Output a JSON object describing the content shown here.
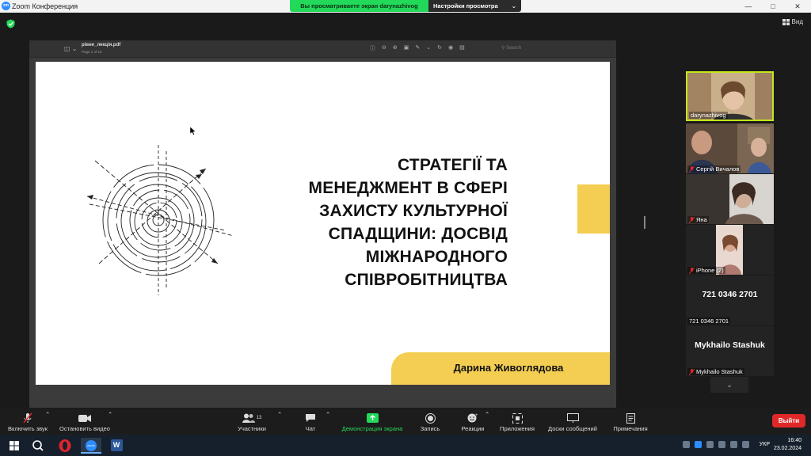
{
  "app": {
    "window_title": "Zoom Конференция",
    "logo_text": "zm"
  },
  "share_banner": {
    "message": "Вы просматриваете экран darynazhivog",
    "options_label": "Настройки просмотра"
  },
  "view_button": {
    "label": "Вид"
  },
  "pdf_viewer": {
    "filename": "рівне_лекція.pdf",
    "page_info": "Page 1 of 15",
    "search_placeholder": "Search"
  },
  "slide": {
    "title_lines": [
      "СТРАТЕГІЇ ТА",
      "МЕНЕДЖМЕНТ В СФЕРІ",
      "ЗАХИСТУ КУЛЬТУРНОЇ",
      "СПАДЩИНИ: ДОСВІД",
      "МІЖНАРОДНОГО",
      "СПІВРОБІТНИЦТВА"
    ],
    "author": "Дарина Живоглядова",
    "accent_color": "#f4ce52"
  },
  "participants": [
    {
      "name": "darynazhivog",
      "type": "video",
      "active_speaker": true,
      "muted": false
    },
    {
      "name": "Сергій Вичалов",
      "type": "video",
      "muted": true
    },
    {
      "name": "Яна",
      "type": "video",
      "muted": true
    },
    {
      "name": "iPhone (2)",
      "type": "video",
      "muted": true
    },
    {
      "name": "721 0346 2701",
      "type": "name",
      "display": "721 0346 2701",
      "muted": false
    },
    {
      "name": "Mykhailo Stashuk",
      "type": "name",
      "display": "Mykhailo Stashuk",
      "muted": true
    }
  ],
  "controls": {
    "audio": "Включить звук",
    "video": "Остановить видео",
    "participants": "Участники",
    "participants_count": "13",
    "chat": "Чат",
    "share": "Демонстрация экрана",
    "record": "Запись",
    "reactions": "Реакции",
    "apps": "Приложения",
    "whiteboards": "Доски сообщений",
    "notes": "Примечания",
    "leave": "Выйти"
  },
  "taskbar": {
    "language": "УКР",
    "time": "16:40",
    "date": "23.02.2024",
    "word_label": "W",
    "zoom_label": "zoom"
  },
  "colors": {
    "share_green": "#23d959",
    "active_speaker": "#c4e61b",
    "leave_red": "#e02828",
    "zoom_blue": "#2d8cff"
  }
}
